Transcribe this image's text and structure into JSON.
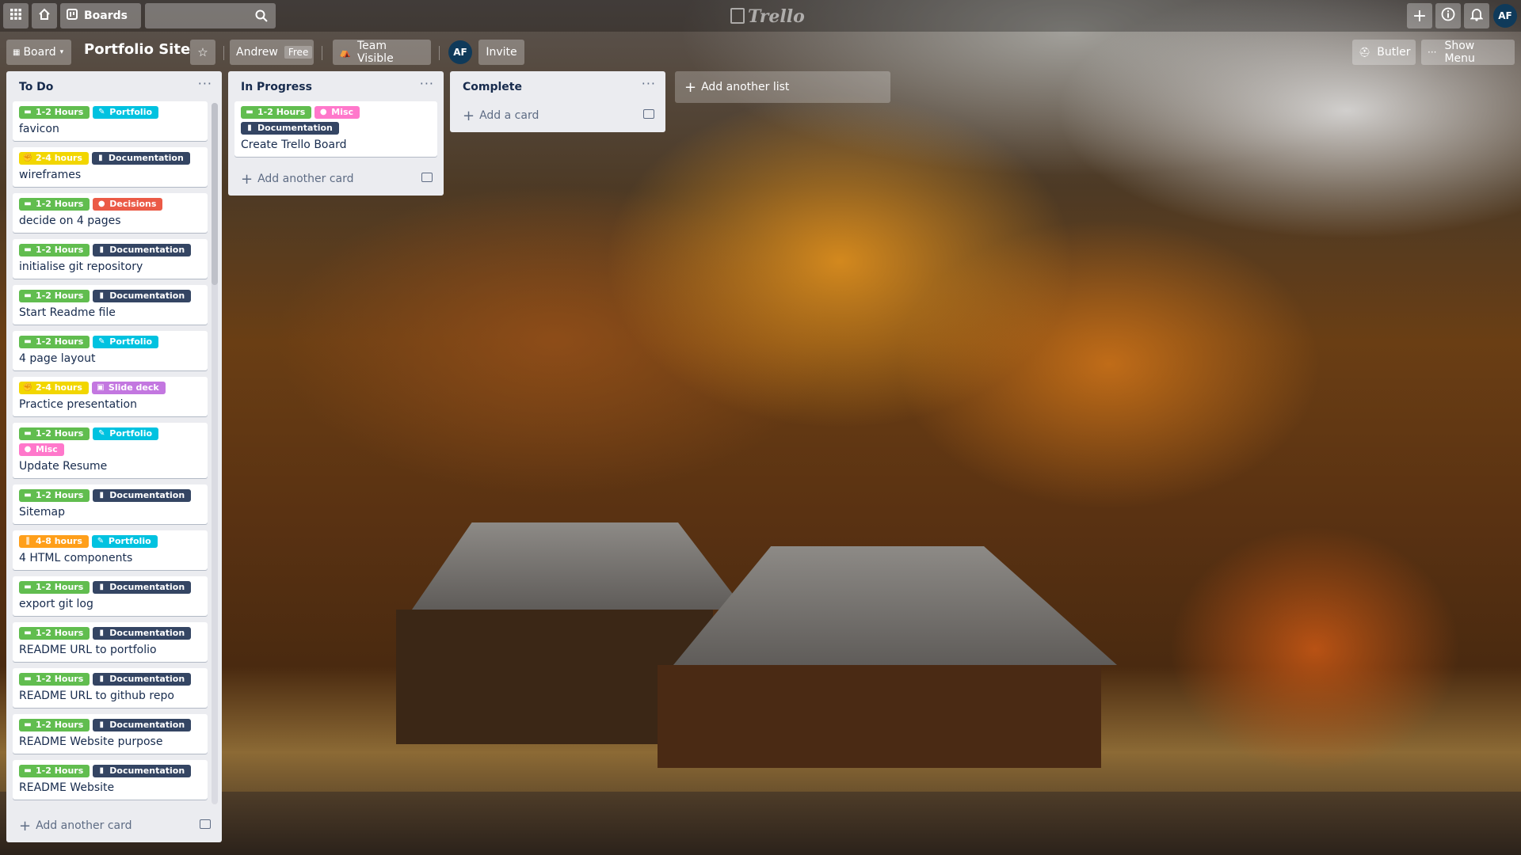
{
  "header": {
    "boards_label": "Boards",
    "logo_text": "Trello",
    "user_initials": "AF"
  },
  "board": {
    "view_label": "Board",
    "title": "Portfolio Site",
    "team_name": "Andrew",
    "team_plan": "Free",
    "visibility": "Team Visible",
    "member_initials": "AF",
    "invite_label": "Invite",
    "butler_label": "Butler",
    "show_menu_label": "Show Menu",
    "add_list_label": "Add another list"
  },
  "label_colors": {
    "green": "#61bd4f",
    "yellow": "#f2d600",
    "orange": "#ff9f1a",
    "red": "#eb5a46",
    "purple": "#c377e0",
    "blue": "#00c2e0",
    "pink": "#ff78cb",
    "black": "#344563"
  },
  "lists": [
    {
      "title": "To Do",
      "add_card_label": "Add another card",
      "cards": [
        {
          "labels": [
            {
              "text": "1-2 Hours",
              "color": "green",
              "icon": "tape-icon"
            },
            {
              "text": "Portfolio",
              "color": "blue",
              "icon": "pen-icon"
            }
          ],
          "title": "favicon"
        },
        {
          "labels": [
            {
              "text": "2-4 hours",
              "color": "yellow",
              "icon": "fist-icon"
            },
            {
              "text": "Documentation",
              "color": "black",
              "icon": "book-icon"
            }
          ],
          "title": "wireframes"
        },
        {
          "labels": [
            {
              "text": "1-2 Hours",
              "color": "green",
              "icon": "tape-icon"
            },
            {
              "text": "Decisions",
              "color": "red",
              "icon": "dots-icon"
            }
          ],
          "title": "decide on 4 pages"
        },
        {
          "labels": [
            {
              "text": "1-2 Hours",
              "color": "green",
              "icon": "tape-icon"
            },
            {
              "text": "Documentation",
              "color": "black",
              "icon": "book-icon"
            }
          ],
          "title": "initialise git repository"
        },
        {
          "labels": [
            {
              "text": "1-2 Hours",
              "color": "green",
              "icon": "tape-icon"
            },
            {
              "text": "Documentation",
              "color": "black",
              "icon": "book-icon"
            }
          ],
          "title": "Start Readme file"
        },
        {
          "labels": [
            {
              "text": "1-2 Hours",
              "color": "green",
              "icon": "tape-icon"
            },
            {
              "text": "Portfolio",
              "color": "blue",
              "icon": "pen-icon"
            }
          ],
          "title": "4 page layout"
        },
        {
          "labels": [
            {
              "text": "2-4 hours",
              "color": "yellow",
              "icon": "fist-icon"
            },
            {
              "text": "Slide deck",
              "color": "purple",
              "icon": "slides-icon"
            }
          ],
          "title": "Practice presentation"
        },
        {
          "labels": [
            {
              "text": "1-2 Hours",
              "color": "green",
              "icon": "tape-icon"
            },
            {
              "text": "Portfolio",
              "color": "blue",
              "icon": "pen-icon"
            },
            {
              "text": "Misc",
              "color": "pink",
              "icon": "dots-icon"
            }
          ],
          "title": "Update Resume"
        },
        {
          "labels": [
            {
              "text": "1-2 Hours",
              "color": "green",
              "icon": "tape-icon"
            },
            {
              "text": "Documentation",
              "color": "black",
              "icon": "book-icon"
            }
          ],
          "title": "Sitemap"
        },
        {
          "labels": [
            {
              "text": "4-8 hours",
              "color": "orange",
              "icon": "bars-icon"
            },
            {
              "text": "Portfolio",
              "color": "blue",
              "icon": "pen-icon"
            }
          ],
          "title": "4 HTML components"
        },
        {
          "labels": [
            {
              "text": "1-2 Hours",
              "color": "green",
              "icon": "tape-icon"
            },
            {
              "text": "Documentation",
              "color": "black",
              "icon": "book-icon"
            }
          ],
          "title": "export git log"
        },
        {
          "labels": [
            {
              "text": "1-2 Hours",
              "color": "green",
              "icon": "tape-icon"
            },
            {
              "text": "Documentation",
              "color": "black",
              "icon": "book-icon"
            }
          ],
          "title": "README URL to portfolio"
        },
        {
          "labels": [
            {
              "text": "1-2 Hours",
              "color": "green",
              "icon": "tape-icon"
            },
            {
              "text": "Documentation",
              "color": "black",
              "icon": "book-icon"
            }
          ],
          "title": "README URL to github repo"
        },
        {
          "labels": [
            {
              "text": "1-2 Hours",
              "color": "green",
              "icon": "tape-icon"
            },
            {
              "text": "Documentation",
              "color": "black",
              "icon": "book-icon"
            }
          ],
          "title": "README Website purpose"
        },
        {
          "labels": [
            {
              "text": "1-2 Hours",
              "color": "green",
              "icon": "tape-icon"
            },
            {
              "text": "Documentation",
              "color": "black",
              "icon": "book-icon"
            }
          ],
          "title": "README Website"
        }
      ]
    },
    {
      "title": "In Progress",
      "add_card_label": "Add another card",
      "cards": [
        {
          "labels": [
            {
              "text": "1-2 Hours",
              "color": "green",
              "icon": "tape-icon"
            },
            {
              "text": "Misc",
              "color": "pink",
              "icon": "dots-icon"
            },
            {
              "text": "Documentation",
              "color": "black",
              "icon": "book-icon"
            }
          ],
          "title": "Create Trello Board"
        }
      ]
    },
    {
      "title": "Complete",
      "add_card_label": "Add a card",
      "cards": []
    }
  ]
}
